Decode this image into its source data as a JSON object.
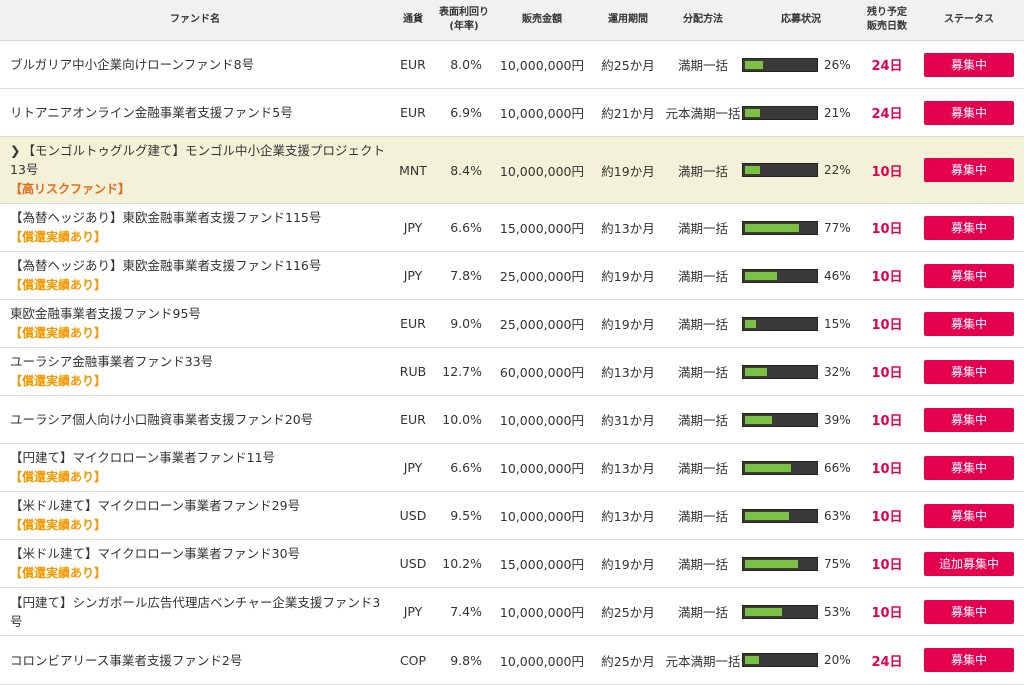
{
  "headers": {
    "fund_name": "ファンド名",
    "currency": "通貨",
    "yield_line1": "表面利回り",
    "yield_line2": "(年率)",
    "amount": "販売金額",
    "period": "運用期間",
    "distribution": "分配方法",
    "subscription": "応募状況",
    "remaining_line1": "残り予定",
    "remaining_line2": "販売日数",
    "status": "ステータス"
  },
  "rows": [
    {
      "name": "ブルガリア中小企業向けローンファンド8号",
      "badge": "",
      "currency": "EUR",
      "rate": "8.0%",
      "amount": "10,000,000円",
      "period": "約25か月",
      "distribution": "満期一括",
      "progress": 26,
      "progress_label": "26%",
      "days": "24日",
      "status": "募集中"
    },
    {
      "name": "リトアニアオンライン金融事業者支援ファンド5号",
      "badge": "",
      "currency": "EUR",
      "rate": "6.9%",
      "amount": "10,000,000円",
      "period": "約21か月",
      "distribution": "元本満期一括",
      "progress": 21,
      "progress_label": "21%",
      "days": "24日",
      "status": "募集中"
    },
    {
      "name": "【モンゴルトゥグルグ建て】モンゴル中小企業支援プロジェクト13号",
      "badge": "【高リスクファンド】",
      "currency": "MNT",
      "rate": "8.4%",
      "amount": "10,000,000円",
      "period": "約19か月",
      "distribution": "満期一括",
      "progress": 22,
      "progress_label": "22%",
      "days": "10日",
      "status": "募集中"
    },
    {
      "name": "【為替ヘッジあり】東欧金融事業者支援ファンド115号",
      "badge": "【償還実績あり】",
      "currency": "JPY",
      "rate": "6.6%",
      "amount": "15,000,000円",
      "period": "約13か月",
      "distribution": "満期一括",
      "progress": 77,
      "progress_label": "77%",
      "days": "10日",
      "status": "募集中"
    },
    {
      "name": "【為替ヘッジあり】東欧金融事業者支援ファンド116号",
      "badge": "【償還実績あり】",
      "currency": "JPY",
      "rate": "7.8%",
      "amount": "25,000,000円",
      "period": "約19か月",
      "distribution": "満期一括",
      "progress": 46,
      "progress_label": "46%",
      "days": "10日",
      "status": "募集中"
    },
    {
      "name": "東欧金融事業者支援ファンド95号",
      "badge": "【償還実績あり】",
      "currency": "EUR",
      "rate": "9.0%",
      "amount": "25,000,000円",
      "period": "約19か月",
      "distribution": "満期一括",
      "progress": 15,
      "progress_label": "15%",
      "days": "10日",
      "status": "募集中"
    },
    {
      "name": "ユーラシア金融事業者ファンド33号",
      "badge": "【償還実績あり】",
      "currency": "RUB",
      "rate": "12.7%",
      "amount": "60,000,000円",
      "period": "約13か月",
      "distribution": "満期一括",
      "progress": 32,
      "progress_label": "32%",
      "days": "10日",
      "status": "募集中"
    },
    {
      "name": "ユーラシア個人向け小口融資事業者支援ファンド20号",
      "badge": "",
      "currency": "EUR",
      "rate": "10.0%",
      "amount": "10,000,000円",
      "period": "約31か月",
      "distribution": "満期一括",
      "progress": 39,
      "progress_label": "39%",
      "days": "10日",
      "status": "募集中"
    },
    {
      "name": "【円建て】マイクロローン事業者ファンド11号",
      "badge": "【償還実績あり】",
      "currency": "JPY",
      "rate": "6.6%",
      "amount": "10,000,000円",
      "period": "約13か月",
      "distribution": "満期一括",
      "progress": 66,
      "progress_label": "66%",
      "days": "10日",
      "status": "募集中"
    },
    {
      "name": "【米ドル建て】マイクロローン事業者ファンド29号",
      "badge": "【償還実績あり】",
      "currency": "USD",
      "rate": "9.5%",
      "amount": "10,000,000円",
      "period": "約13か月",
      "distribution": "満期一括",
      "progress": 63,
      "progress_label": "63%",
      "days": "10日",
      "status": "募集中"
    },
    {
      "name": "【米ドル建て】マイクロローン事業者ファンド30号",
      "badge": "【償還実績あり】",
      "currency": "USD",
      "rate": "10.2%",
      "amount": "15,000,000円",
      "period": "約19か月",
      "distribution": "満期一括",
      "progress": 75,
      "progress_label": "75%",
      "days": "10日",
      "status": "追加募集中"
    },
    {
      "name": "【円建て】シンガポール広告代理店ベンチャー企業支援ファンド3号",
      "badge": "",
      "currency": "JPY",
      "rate": "7.4%",
      "amount": "10,000,000円",
      "period": "約25か月",
      "distribution": "満期一括",
      "progress": 53,
      "progress_label": "53%",
      "days": "10日",
      "status": "募集中"
    },
    {
      "name": "コロンビアリース事業者支援ファンド2号",
      "badge": "",
      "currency": "COP",
      "rate": "9.8%",
      "amount": "10,000,000円",
      "period": "約25か月",
      "distribution": "元本満期一括",
      "progress": 20,
      "progress_label": "20%",
      "days": "24日",
      "status": "募集中"
    }
  ],
  "highlight_row": 2,
  "colors": {
    "accent": "#e4004f",
    "bar_fill": "#7cc242",
    "badge": "#f39800",
    "highlight": "#f3f2d8"
  }
}
